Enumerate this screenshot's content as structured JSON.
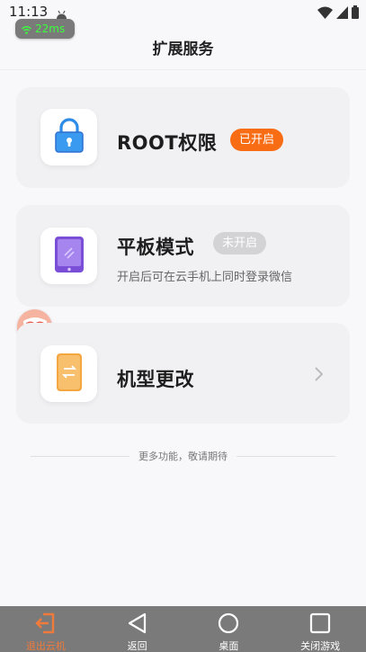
{
  "status_bar": {
    "time": "11:13",
    "network_latency": "22ms"
  },
  "header": {
    "title": "扩展服务"
  },
  "cards": {
    "root": {
      "title": "ROOT权限",
      "badge": "已开启",
      "badge_color": "#f86d14",
      "icon": "lock-icon"
    },
    "tablet": {
      "title": "平板模式",
      "badge": "未开启",
      "badge_color": "#d3d3d6",
      "description": "开启后可在云手机上同时登录微信",
      "icon": "tablet-icon"
    },
    "model": {
      "title": "机型更改",
      "icon": "phone-swap-icon"
    }
  },
  "footer_note": "更多功能，敬请期待",
  "bottom_nav": [
    {
      "label": "退出云机",
      "icon": "exit-icon",
      "color": "#f07a3b"
    },
    {
      "label": "返回",
      "icon": "back-triangle-icon"
    },
    {
      "label": "桌面",
      "icon": "home-circle-icon"
    },
    {
      "label": "关闭游戏",
      "icon": "square-icon"
    }
  ]
}
